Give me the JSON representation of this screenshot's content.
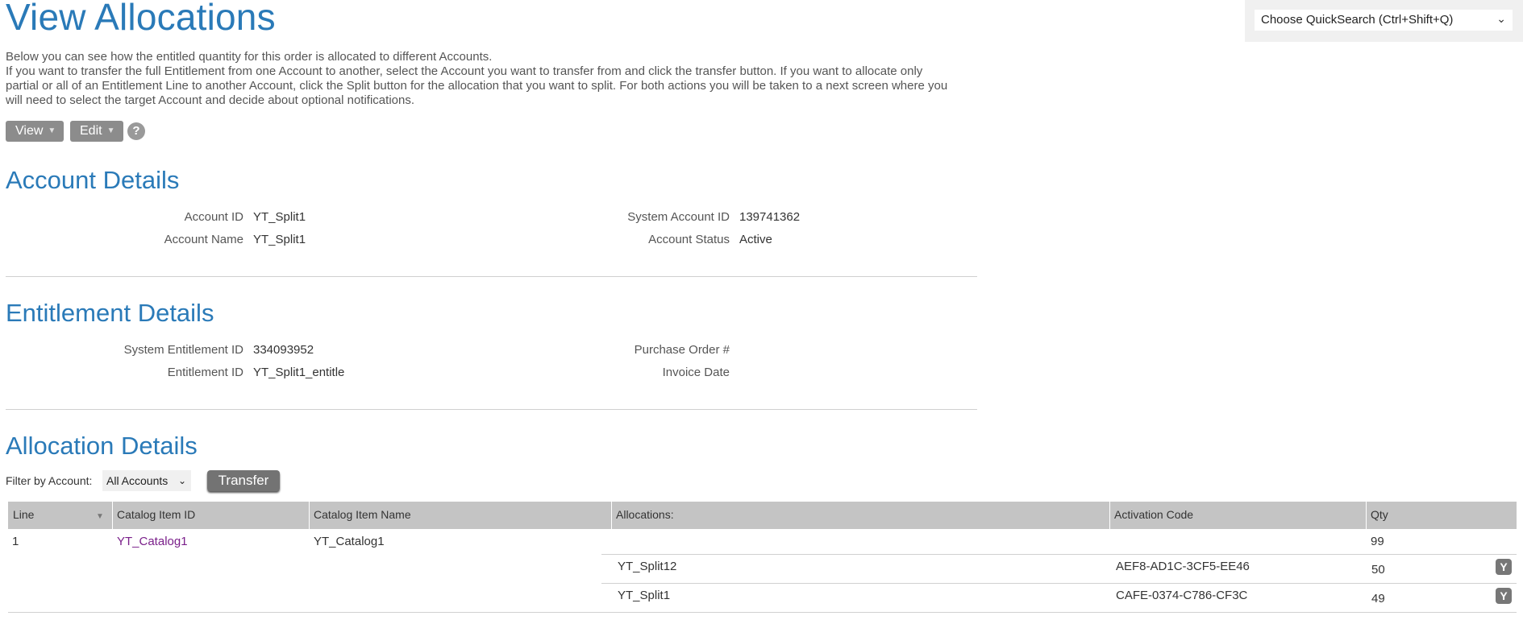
{
  "page": {
    "title": "View Allocations",
    "intro_line1": "Below you can see how the entitled quantity for this order is allocated to different Accounts.",
    "intro_line2": "If you want to transfer the full Entitlement from one Account to another, select the Account you want to transfer from and click the transfer button. If you want to allocate only partial or all of an Entitlement Line to another Account, click the Split button for the allocation that you want to split. For both actions you will be taken to a next screen where you will need to select the target Account and decide about optional notifications."
  },
  "quicksearch": {
    "label": "Choose QuickSearch (Ctrl+Shift+Q)",
    "icon": "chevron-down-icon"
  },
  "toolbar": {
    "view_label": "View",
    "edit_label": "Edit",
    "help_label": "?"
  },
  "account": {
    "title": "Account Details",
    "id_label": "Account ID",
    "id_value": "YT_Split1",
    "name_label": "Account Name",
    "name_value": "YT_Split1",
    "sys_id_label": "System Account ID",
    "sys_id_value": "139741362",
    "status_label": "Account Status",
    "status_value": "Active"
  },
  "entitlement": {
    "title": "Entitlement Details",
    "sys_id_label": "System Entitlement ID",
    "sys_id_value": "334093952",
    "id_label": "Entitlement ID",
    "id_value": "YT_Split1_entitle",
    "po_label": "Purchase Order #",
    "po_value": "",
    "invoice_label": "Invoice Date",
    "invoice_value": ""
  },
  "allocation": {
    "title": "Allocation Details",
    "filter_label": "Filter by Account:",
    "filter_value": "All Accounts",
    "transfer_label": "Transfer",
    "columns": [
      "Line",
      "Catalog Item ID",
      "Catalog Item Name",
      "Allocations:",
      "Activation Code",
      "Qty"
    ],
    "line": {
      "line": "1",
      "catalog_id": "YT_Catalog1",
      "catalog_name": "YT_Catalog1",
      "qty": "99"
    },
    "allocations": [
      {
        "account": "YT_Split12",
        "code": "AEF8-AD1C-3CF5-EE46",
        "qty": "50"
      },
      {
        "account": "YT_Split1",
        "code": "CAFE-0374-C786-CF3C",
        "qty": "49"
      }
    ]
  },
  "colors": {
    "accent": "#2a7ab8",
    "link": "#1f6fae",
    "visited_link": "#7a1f8a",
    "header_bg": "#c4c4c4"
  }
}
